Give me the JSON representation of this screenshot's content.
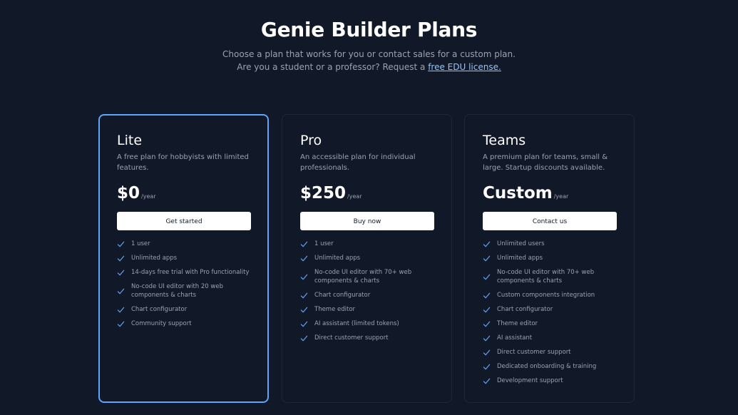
{
  "header": {
    "title": "Genie Builder Plans",
    "subtitle_line1": "Choose a plan that works for you or contact sales for a custom plan.",
    "subtitle_line2_prefix": "Are you a student or a professor? Request a ",
    "edu_link": "free EDU license."
  },
  "colors": {
    "background": "#111827",
    "featured_border": "#60a5fa",
    "check": "#60a5fa",
    "link": "#93c5fd"
  },
  "plans": [
    {
      "name": "Lite",
      "description": "A free plan for hobbyists with limited features.",
      "price": "$0",
      "period": "/year",
      "cta": "Get started",
      "features": [
        "1 user",
        "Unlimited apps",
        "14-days free trial with Pro functionality",
        "No-code UI editor with 20 web components & charts",
        "Chart configurator",
        "Community support"
      ]
    },
    {
      "name": "Pro",
      "description": "An accessible plan for individual professionals.",
      "price": "$250",
      "period": "/year",
      "cta": "Buy now",
      "features": [
        "1 user",
        "Unlimited apps",
        "No-code UI editor with 70+ web components & charts",
        "Chart configurator",
        "Theme editor",
        "AI assistant (limited tokens)",
        "Direct customer support"
      ]
    },
    {
      "name": "Teams",
      "description": "A premium plan for teams, small & large. Startup discounts available.",
      "price": "Custom",
      "period": "/year",
      "cta": "Contact us",
      "features": [
        "Unlimited users",
        "Unlimited apps",
        "No-code UI editor with 70+ web components & charts",
        "Custom components integration",
        "Chart configurator",
        "Theme editor",
        "AI assistant",
        "Direct customer support",
        "Dedicated onboarding & training",
        "Development support"
      ]
    }
  ]
}
